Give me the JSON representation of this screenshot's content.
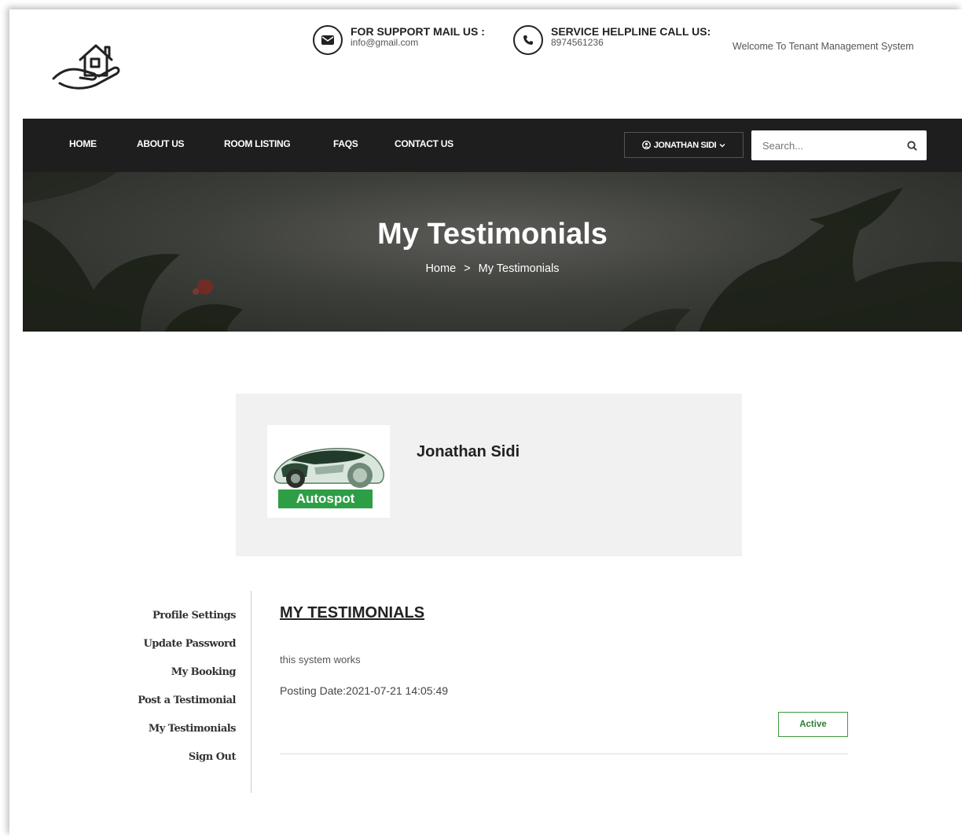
{
  "header": {
    "support_title": "FOR SUPPORT MAIL US :",
    "support_value": "info@gmail.com",
    "helpline_title": "SERVICE HELPLINE CALL US:",
    "helpline_value": "8974561236",
    "welcome": "Welcome To Tenant Management System"
  },
  "nav": {
    "items": [
      {
        "label": "HOME"
      },
      {
        "label": "ABOUT US"
      },
      {
        "label": "ROOM LISTING"
      },
      {
        "label": "FAQS"
      },
      {
        "label": "CONTACT US"
      }
    ],
    "user_label": "JONATHAN SIDI",
    "search_placeholder": "Search..."
  },
  "banner": {
    "title": "My Testimonials",
    "breadcrumb_home": "Home",
    "breadcrumb_separator": ">",
    "breadcrumb_current": "My Testimonials"
  },
  "profile": {
    "name": "Jonathan Sidi",
    "avatar_caption": "Autospot"
  },
  "sidebar": {
    "items": [
      {
        "label": "Profile Settings"
      },
      {
        "label": "Update Password"
      },
      {
        "label": "My Booking"
      },
      {
        "label": "Post a Testimonial"
      },
      {
        "label": "My Testimonials"
      },
      {
        "label": "Sign Out"
      }
    ]
  },
  "testimonials": {
    "heading": "MY TESTIMONIALS",
    "items": [
      {
        "text": "this system works",
        "date_label": "Posting Date:2021-07-21 14:05:49",
        "status": "Active"
      }
    ]
  },
  "colors": {
    "nav_bg": "#1e1e1e",
    "card_bg": "#f1f1f1",
    "badge_green": "#2e7d32",
    "avatar_label_bg": "#2e9e46"
  }
}
